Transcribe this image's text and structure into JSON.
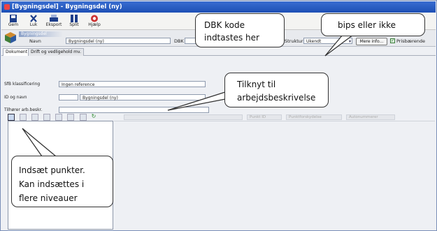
{
  "window": {
    "title": "[Bygningsdel] - Bygningsdel (ny)"
  },
  "toolbar": {
    "buttons": [
      {
        "label": "Gem",
        "icon": "save-icon"
      },
      {
        "label": "Luk",
        "icon": "close-icon"
      },
      {
        "label": "Eksport",
        "icon": "print-icon"
      },
      {
        "label": "Split",
        "icon": "split-icon"
      },
      {
        "label": "Hjælp",
        "icon": "help-icon"
      }
    ]
  },
  "header": {
    "section": "Bygningsdel",
    "name_label": "Navn",
    "name_value": "Bygningsdel (ny)",
    "dbk_label": "DBK",
    "dbk_value": "",
    "struktur_label": "Struktur",
    "struktur_value": "Ukendt",
    "more_info_label": "Mere info...",
    "prisbaerende_label": "Prisbærende",
    "prisbaerende_checked": true
  },
  "tabs": [
    "Dokument",
    "Drift og vedligehold mv."
  ],
  "form": {
    "sfb_label": "SfB klassificering",
    "sfb_value": "Ingen reference",
    "id_label": "ID og navn",
    "id_value": "",
    "id_name_value": "Bygningsdel (ny)",
    "tilhorer_label": "Tilhører arb.beskr.",
    "tilhorer_value": ""
  },
  "list_toolbar": {
    "fields": [
      "Punkt ID",
      "Punktforskydelse",
      "Autonummerer"
    ]
  },
  "callouts": {
    "dbk": [
      "DBK kode",
      "indtastes her"
    ],
    "bips": [
      "bips eller ikke"
    ],
    "tilknyt": [
      "Tilknyt til",
      "arbejdsbeskrivelse"
    ],
    "indsaet": [
      "Indsæt punkter.",
      "Kan indsættes i",
      "flere niveauer"
    ]
  },
  "colors": {
    "titlebar": "#2a5cc4",
    "panel": "#eef0f4",
    "border": "#8e9aae",
    "check": "#1b6b1b"
  }
}
